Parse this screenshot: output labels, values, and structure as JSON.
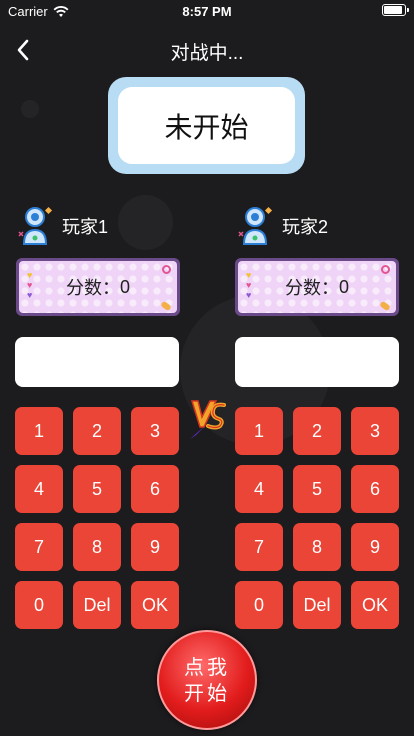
{
  "status_bar": {
    "carrier": "Carrier",
    "time": "8:57 PM"
  },
  "nav": {
    "title": "对战中...",
    "back_icon": "chevron-left-icon"
  },
  "game_status": "未开始",
  "players": [
    {
      "name": "玩家1",
      "score_label": "分数：",
      "score": "0",
      "input_value": ""
    },
    {
      "name": "玩家2",
      "score_label": "分数：",
      "score": "0",
      "input_value": ""
    }
  ],
  "keypad": [
    "1",
    "2",
    "3",
    "4",
    "5",
    "6",
    "7",
    "8",
    "9",
    "0",
    "Del",
    "OK"
  ],
  "start_button": "点我开始",
  "colors": {
    "key": "#eb4537",
    "background": "#1c1c1e",
    "status_card": "#b8dcf3",
    "score_box": "#efd4f7"
  }
}
